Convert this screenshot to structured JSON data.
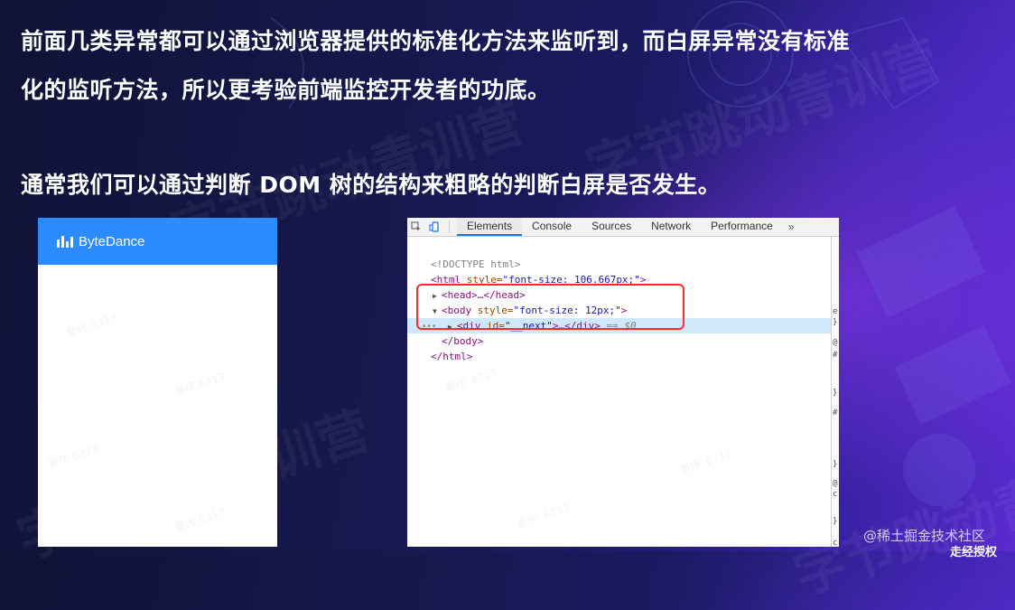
{
  "slide": {
    "line1": "前面几类异常都可以通过浏览器提供的标准化方法来监听到，而白屏异常没有标准",
    "line2": "化的监听方法，所以更考验前端监控开发者的功底。",
    "line3": "通常我们可以通过判断 DOM 树的结构来粗略的判断白屏是否发生。"
  },
  "phone": {
    "logo_text": "ByteDance",
    "header_color": "#2c8bff"
  },
  "devtools": {
    "tabs": [
      {
        "label": "Elements",
        "active": true
      },
      {
        "label": "Console",
        "active": false
      },
      {
        "label": "Sources",
        "active": false
      },
      {
        "label": "Network",
        "active": false
      },
      {
        "label": "Performance",
        "active": false
      }
    ],
    "more": "»",
    "doctype": "<!DOCTYPE html>",
    "html_open": {
      "tag_open": "<html",
      "attr": " style=",
      "value": "\"font-size: 106.667px;\"",
      "tag_close": ">"
    },
    "head": {
      "text": "<head>…</head>"
    },
    "body_open": {
      "tag_open": "<body",
      "attr": " style=",
      "value": "\"font-size: 12px;\"",
      "tag_close": ">"
    },
    "div_line": {
      "tag_open": "<div",
      "attr": " id=",
      "value": "\"__next\"",
      "tag_close": ">…</div>",
      "suffix": " == $0"
    },
    "body_close": "</body>",
    "html_close": "</html>",
    "sidebar_marks": [
      "e",
      "}",
      "@",
      "#",
      "}",
      "#",
      "}",
      "@",
      "c",
      "}",
      "c"
    ]
  },
  "watermark": {
    "small": "秦伟 6313",
    "large": "字节跳动青训营"
  },
  "credit": {
    "text": "@稀土掘金技术社区",
    "text2": "走经授权"
  },
  "colors": {
    "highlight": "#ff2b2b",
    "selected_row": "#cfe8fc",
    "tab_active": "#1a73e8"
  }
}
